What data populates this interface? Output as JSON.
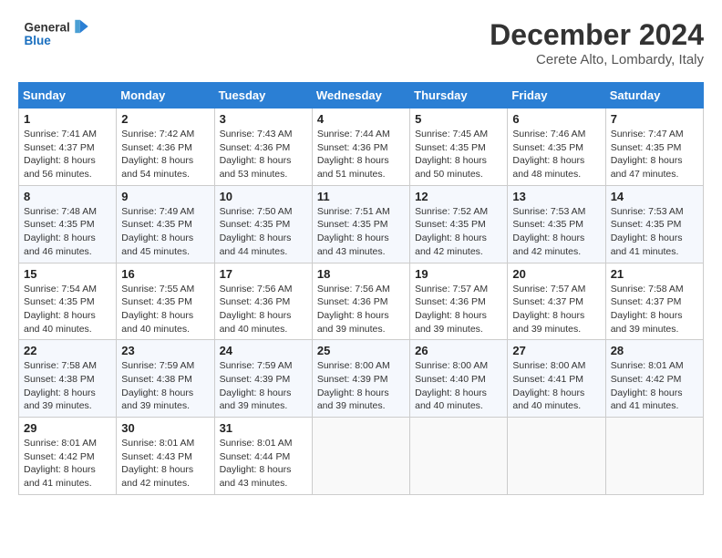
{
  "header": {
    "logo_line1": "General",
    "logo_line2": "Blue",
    "month_title": "December 2024",
    "location": "Cerete Alto, Lombardy, Italy"
  },
  "weekdays": [
    "Sunday",
    "Monday",
    "Tuesday",
    "Wednesday",
    "Thursday",
    "Friday",
    "Saturday"
  ],
  "weeks": [
    [
      {
        "day": "1",
        "sunrise": "Sunrise: 7:41 AM",
        "sunset": "Sunset: 4:37 PM",
        "daylight": "Daylight: 8 hours and 56 minutes."
      },
      {
        "day": "2",
        "sunrise": "Sunrise: 7:42 AM",
        "sunset": "Sunset: 4:36 PM",
        "daylight": "Daylight: 8 hours and 54 minutes."
      },
      {
        "day": "3",
        "sunrise": "Sunrise: 7:43 AM",
        "sunset": "Sunset: 4:36 PM",
        "daylight": "Daylight: 8 hours and 53 minutes."
      },
      {
        "day": "4",
        "sunrise": "Sunrise: 7:44 AM",
        "sunset": "Sunset: 4:36 PM",
        "daylight": "Daylight: 8 hours and 51 minutes."
      },
      {
        "day": "5",
        "sunrise": "Sunrise: 7:45 AM",
        "sunset": "Sunset: 4:35 PM",
        "daylight": "Daylight: 8 hours and 50 minutes."
      },
      {
        "day": "6",
        "sunrise": "Sunrise: 7:46 AM",
        "sunset": "Sunset: 4:35 PM",
        "daylight": "Daylight: 8 hours and 48 minutes."
      },
      {
        "day": "7",
        "sunrise": "Sunrise: 7:47 AM",
        "sunset": "Sunset: 4:35 PM",
        "daylight": "Daylight: 8 hours and 47 minutes."
      }
    ],
    [
      {
        "day": "8",
        "sunrise": "Sunrise: 7:48 AM",
        "sunset": "Sunset: 4:35 PM",
        "daylight": "Daylight: 8 hours and 46 minutes."
      },
      {
        "day": "9",
        "sunrise": "Sunrise: 7:49 AM",
        "sunset": "Sunset: 4:35 PM",
        "daylight": "Daylight: 8 hours and 45 minutes."
      },
      {
        "day": "10",
        "sunrise": "Sunrise: 7:50 AM",
        "sunset": "Sunset: 4:35 PM",
        "daylight": "Daylight: 8 hours and 44 minutes."
      },
      {
        "day": "11",
        "sunrise": "Sunrise: 7:51 AM",
        "sunset": "Sunset: 4:35 PM",
        "daylight": "Daylight: 8 hours and 43 minutes."
      },
      {
        "day": "12",
        "sunrise": "Sunrise: 7:52 AM",
        "sunset": "Sunset: 4:35 PM",
        "daylight": "Daylight: 8 hours and 42 minutes."
      },
      {
        "day": "13",
        "sunrise": "Sunrise: 7:53 AM",
        "sunset": "Sunset: 4:35 PM",
        "daylight": "Daylight: 8 hours and 42 minutes."
      },
      {
        "day": "14",
        "sunrise": "Sunrise: 7:53 AM",
        "sunset": "Sunset: 4:35 PM",
        "daylight": "Daylight: 8 hours and 41 minutes."
      }
    ],
    [
      {
        "day": "15",
        "sunrise": "Sunrise: 7:54 AM",
        "sunset": "Sunset: 4:35 PM",
        "daylight": "Daylight: 8 hours and 40 minutes."
      },
      {
        "day": "16",
        "sunrise": "Sunrise: 7:55 AM",
        "sunset": "Sunset: 4:35 PM",
        "daylight": "Daylight: 8 hours and 40 minutes."
      },
      {
        "day": "17",
        "sunrise": "Sunrise: 7:56 AM",
        "sunset": "Sunset: 4:36 PM",
        "daylight": "Daylight: 8 hours and 40 minutes."
      },
      {
        "day": "18",
        "sunrise": "Sunrise: 7:56 AM",
        "sunset": "Sunset: 4:36 PM",
        "daylight": "Daylight: 8 hours and 39 minutes."
      },
      {
        "day": "19",
        "sunrise": "Sunrise: 7:57 AM",
        "sunset": "Sunset: 4:36 PM",
        "daylight": "Daylight: 8 hours and 39 minutes."
      },
      {
        "day": "20",
        "sunrise": "Sunrise: 7:57 AM",
        "sunset": "Sunset: 4:37 PM",
        "daylight": "Daylight: 8 hours and 39 minutes."
      },
      {
        "day": "21",
        "sunrise": "Sunrise: 7:58 AM",
        "sunset": "Sunset: 4:37 PM",
        "daylight": "Daylight: 8 hours and 39 minutes."
      }
    ],
    [
      {
        "day": "22",
        "sunrise": "Sunrise: 7:58 AM",
        "sunset": "Sunset: 4:38 PM",
        "daylight": "Daylight: 8 hours and 39 minutes."
      },
      {
        "day": "23",
        "sunrise": "Sunrise: 7:59 AM",
        "sunset": "Sunset: 4:38 PM",
        "daylight": "Daylight: 8 hours and 39 minutes."
      },
      {
        "day": "24",
        "sunrise": "Sunrise: 7:59 AM",
        "sunset": "Sunset: 4:39 PM",
        "daylight": "Daylight: 8 hours and 39 minutes."
      },
      {
        "day": "25",
        "sunrise": "Sunrise: 8:00 AM",
        "sunset": "Sunset: 4:39 PM",
        "daylight": "Daylight: 8 hours and 39 minutes."
      },
      {
        "day": "26",
        "sunrise": "Sunrise: 8:00 AM",
        "sunset": "Sunset: 4:40 PM",
        "daylight": "Daylight: 8 hours and 40 minutes."
      },
      {
        "day": "27",
        "sunrise": "Sunrise: 8:00 AM",
        "sunset": "Sunset: 4:41 PM",
        "daylight": "Daylight: 8 hours and 40 minutes."
      },
      {
        "day": "28",
        "sunrise": "Sunrise: 8:01 AM",
        "sunset": "Sunset: 4:42 PM",
        "daylight": "Daylight: 8 hours and 41 minutes."
      }
    ],
    [
      {
        "day": "29",
        "sunrise": "Sunrise: 8:01 AM",
        "sunset": "Sunset: 4:42 PM",
        "daylight": "Daylight: 8 hours and 41 minutes."
      },
      {
        "day": "30",
        "sunrise": "Sunrise: 8:01 AM",
        "sunset": "Sunset: 4:43 PM",
        "daylight": "Daylight: 8 hours and 42 minutes."
      },
      {
        "day": "31",
        "sunrise": "Sunrise: 8:01 AM",
        "sunset": "Sunset: 4:44 PM",
        "daylight": "Daylight: 8 hours and 43 minutes."
      },
      null,
      null,
      null,
      null
    ]
  ]
}
